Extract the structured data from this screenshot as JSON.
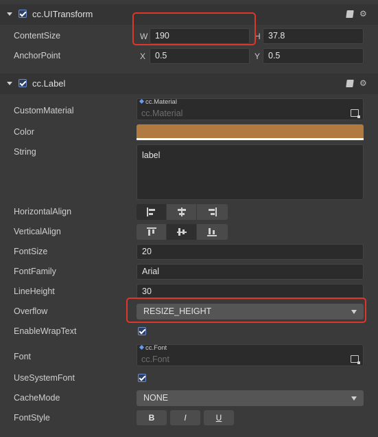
{
  "ui_transform": {
    "title": "cc.UITransform",
    "content_size": {
      "label": "ContentSize",
      "w_axis": "W",
      "w": "190",
      "h_axis": "H",
      "h": "37.8"
    },
    "anchor_point": {
      "label": "AnchorPoint",
      "x_axis": "X",
      "x": "0.5",
      "y_axis": "Y",
      "y": "0.5"
    }
  },
  "label_component": {
    "title": "cc.Label",
    "custom_material": {
      "label": "CustomMaterial",
      "tag": "cc.Material",
      "placeholder": "cc.Material"
    },
    "color": {
      "label": "Color",
      "value": "#b07a41"
    },
    "string": {
      "label": "String",
      "value": "label"
    },
    "horizontal_align": {
      "label": "HorizontalAlign"
    },
    "vertical_align": {
      "label": "VerticalAlign"
    },
    "font_size": {
      "label": "FontSize",
      "value": "20"
    },
    "font_family": {
      "label": "FontFamily",
      "value": "Arial"
    },
    "line_height": {
      "label": "LineHeight",
      "value": "30"
    },
    "overflow": {
      "label": "Overflow",
      "value": "RESIZE_HEIGHT"
    },
    "enable_wrap_text": {
      "label": "EnableWrapText",
      "checked": true
    },
    "font": {
      "label": "Font",
      "tag": "cc.Font",
      "placeholder": "cc.Font"
    },
    "use_system_font": {
      "label": "UseSystemFont",
      "checked": true
    },
    "cache_mode": {
      "label": "CacheMode",
      "value": "NONE"
    },
    "font_style": {
      "label": "FontStyle",
      "bold": "B",
      "italic": "I",
      "underline": "U"
    }
  },
  "colors": {
    "highlight": "#e0352b",
    "checkbox": "#2d3f63"
  }
}
